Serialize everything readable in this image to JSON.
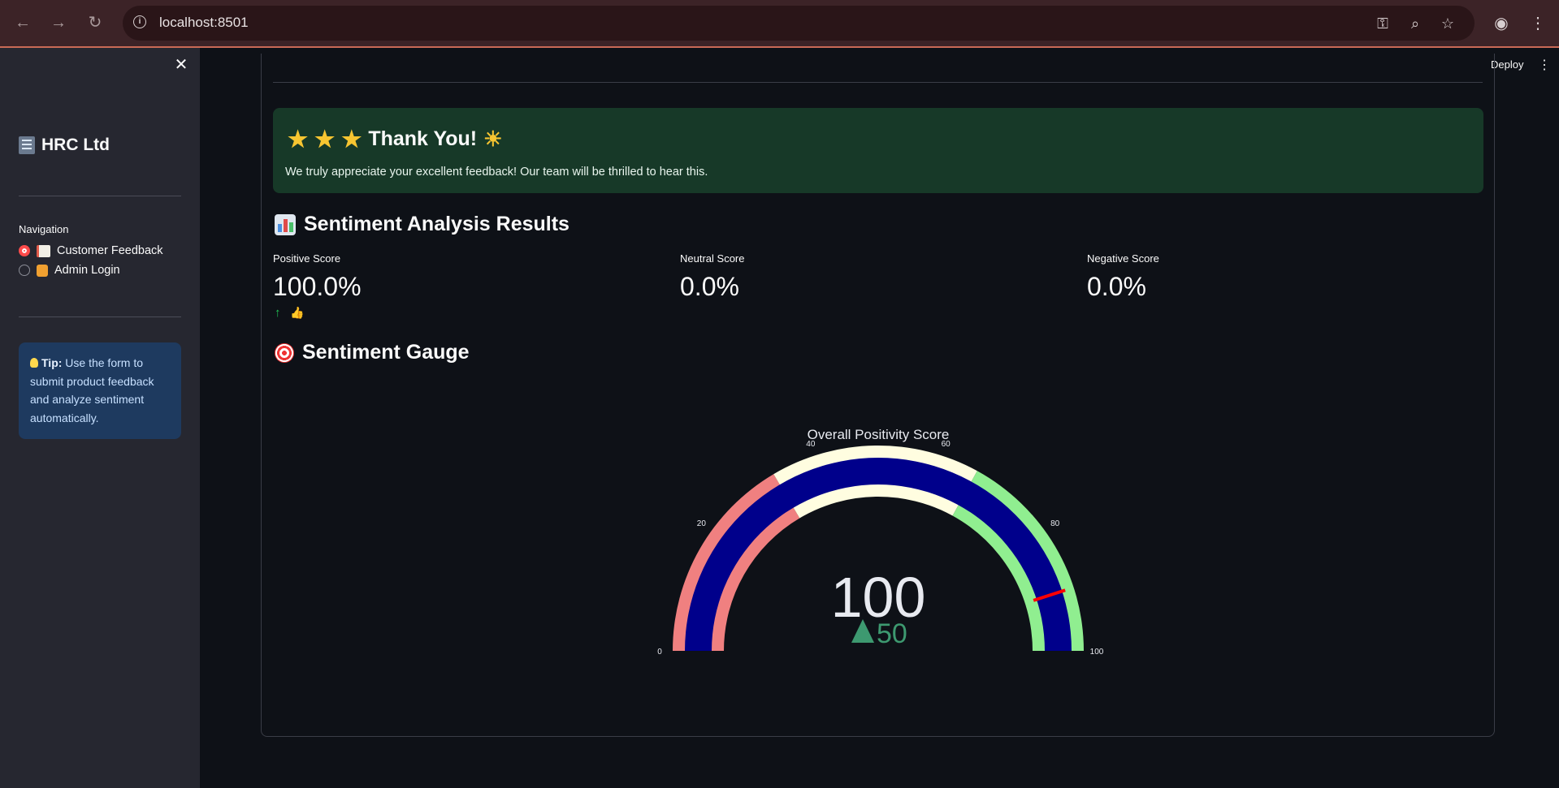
{
  "browser": {
    "url": "localhost:8501"
  },
  "sidebar": {
    "brand": "HRC Ltd",
    "nav_heading": "Navigation",
    "nav_items": [
      {
        "label": "Customer Feedback",
        "selected": true
      },
      {
        "label": "Admin Login",
        "selected": false
      }
    ],
    "tip_bold": "Tip:",
    "tip_text": "Use the form to submit product feedback and analyze sentiment automatically."
  },
  "header": {
    "deploy_label": "Deploy"
  },
  "thanks": {
    "title": "Thank You!",
    "message": "We truly appreciate your excellent feedback! Our team will be thrilled to hear this."
  },
  "results": {
    "title": "Sentiment Analysis Results",
    "metrics": [
      {
        "label": "Positive Score",
        "value": "100.0%"
      },
      {
        "label": "Neutral Score",
        "value": "0.0%"
      },
      {
        "label": "Negative Score",
        "value": "0.0%"
      }
    ],
    "delta_arrow": "↑",
    "delta_icon": "thumbs-up-icon"
  },
  "gauge_section": {
    "title": "Sentiment Gauge"
  },
  "chart_data": {
    "type": "gauge",
    "title": "Overall Positivity Score",
    "value": 100,
    "delta": 50,
    "delta_text": "50",
    "range": [
      0,
      100
    ],
    "ticks": [
      0,
      20,
      40,
      60,
      80,
      100
    ],
    "tick_labels": [
      "0",
      "20",
      "40",
      "60",
      "80",
      "100"
    ],
    "threshold": 90,
    "steps": [
      {
        "range": [
          0,
          33
        ],
        "color": "#f08080"
      },
      {
        "range": [
          33,
          66
        ],
        "color": "#fffde0"
      },
      {
        "range": [
          66,
          100
        ],
        "color": "#90ee90"
      }
    ],
    "bar_color": "#00008b",
    "threshold_color": "#ff0000",
    "value_color": "#e8eaf0",
    "delta_color": "#3d9970"
  }
}
